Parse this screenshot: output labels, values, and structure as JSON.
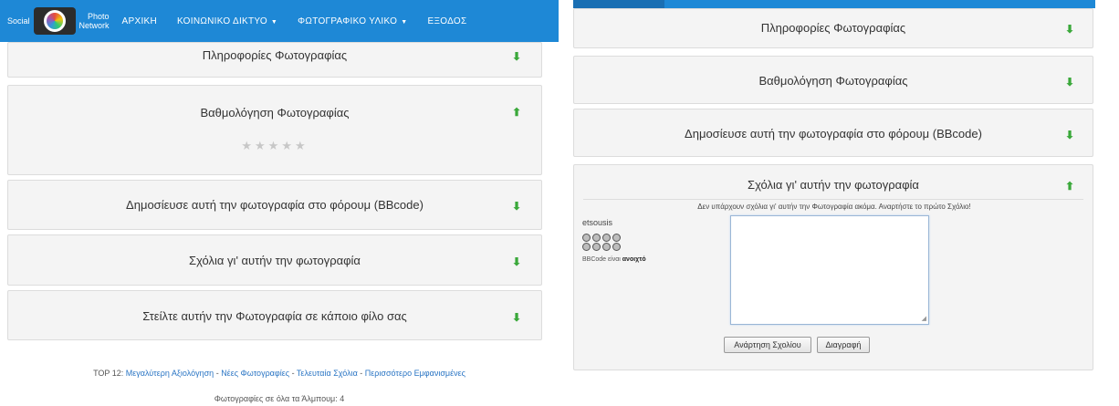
{
  "left": {
    "navbar": {
      "brand_social": "Social",
      "brand_photo_line1": "Photo",
      "brand_photo_line2": "Network",
      "items": [
        {
          "label": "ΑΡΧΙΚΗ",
          "caret": ""
        },
        {
          "label": "ΚΟΙΝΩΝΙΚΟ ΔΙΚΤΥΟ",
          "caret": "▼"
        },
        {
          "label": "ΦΩΤΟΓΡΑΦΙΚΟ ΥΛΙΚΟ",
          "caret": "▼"
        },
        {
          "label": "ΕΞΟΔΟΣ",
          "caret": ""
        }
      ]
    },
    "panels": {
      "info": {
        "title": "Πληροφορίες Φωτογραφίας",
        "arrow": "⬇"
      },
      "rating": {
        "title": "Βαθμολόγηση Φωτογραφίας",
        "arrow": "⬆",
        "stars": "★★★★★"
      },
      "publish": {
        "title": "Δημοσίευσε αυτή την φωτογραφία στο φόρουμ (BBcode)",
        "arrow": "⬇"
      },
      "comments": {
        "title": "Σχόλια γι' αυτήν την φωτογραφία",
        "arrow": "⬇"
      },
      "send": {
        "title": "Στείλτε αυτήν την Φωτογραφία σε κάποιο φίλο σας",
        "arrow": "⬇"
      }
    },
    "footer": {
      "top12_prefix": "TOP 12:",
      "links": [
        "Μεγαλύτερη Αξιολόγηση",
        "Νέες Φωτογραφίες",
        "Τελευταία Σχόλια",
        "Περισσότερο Εμφανισμένες"
      ],
      "separator": " - ",
      "albums": "Φωτογραφίες σε όλα τα Άλμπουμ: 4"
    }
  },
  "right": {
    "panels": {
      "info": {
        "title": "Πληροφορίες Φωτογραφίας",
        "arrow": "⬇"
      },
      "rating": {
        "title": "Βαθμολόγηση Φωτογραφίας",
        "arrow": "⬇"
      },
      "publish": {
        "title": "Δημοσίευσε αυτή την φωτογραφία στο φόρουμ (BBcode)",
        "arrow": "⬇"
      },
      "comments": {
        "title": "Σχόλια γι' αυτήν την φωτογραφία",
        "arrow": "⬆"
      }
    },
    "comments": {
      "empty_message": "Δεν υπάρχουν σχόλια γι' αυτήν την Φωτογραφία ακόμα. Αναρτήστε το πρώτο Σχόλιο!",
      "author": "etsousis",
      "bbcode_prefix": "BBCode είναι",
      "bbcode_state": "ανοιχτό",
      "post_button": "Ανάρτηση Σχολίου",
      "delete_button": "Διαγραφή"
    }
  },
  "colors": {
    "navbar": "#1e88d6",
    "arrow": "#3aa83a",
    "link": "#2a75c4",
    "panel_bg": "#f4f4f4"
  }
}
